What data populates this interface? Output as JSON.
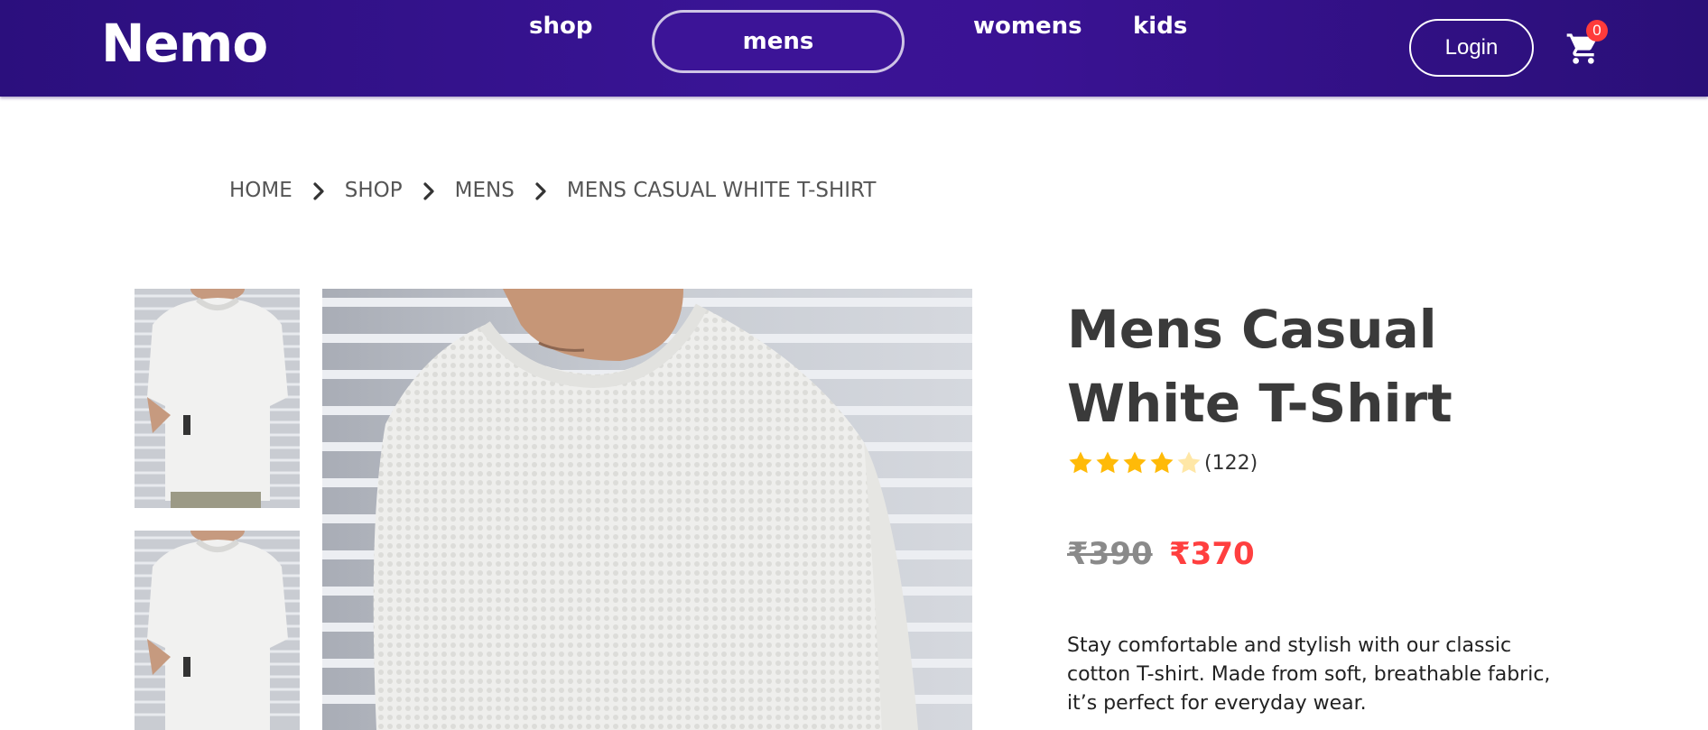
{
  "brand": {
    "name": "Nemo"
  },
  "nav": {
    "items": [
      {
        "label": "shop"
      },
      {
        "label": "mens",
        "active": true
      },
      {
        "label": "womens"
      },
      {
        "label": "kids"
      }
    ],
    "login_label": "Login",
    "cart_count": "0"
  },
  "breadcrumb": [
    "HOME",
    "SHOP",
    "MENS",
    "MENS CASUAL WHITE T-SHIRT"
  ],
  "product": {
    "title": "Mens Casual White T-Shirt",
    "rating": 4,
    "rating_max": 5,
    "review_count": "(122)",
    "old_price": "₹390",
    "new_price": "₹370",
    "description": "Stay comfortable and stylish with our classic cotton T-shirt. Made from soft, breathable fabric, it’s perfect for everyday wear."
  },
  "colors": {
    "nav_bg": "#3a1496",
    "accent_red": "#ff3f3f",
    "star_filled": "#ffba08",
    "star_empty": "#ffe7a6"
  }
}
